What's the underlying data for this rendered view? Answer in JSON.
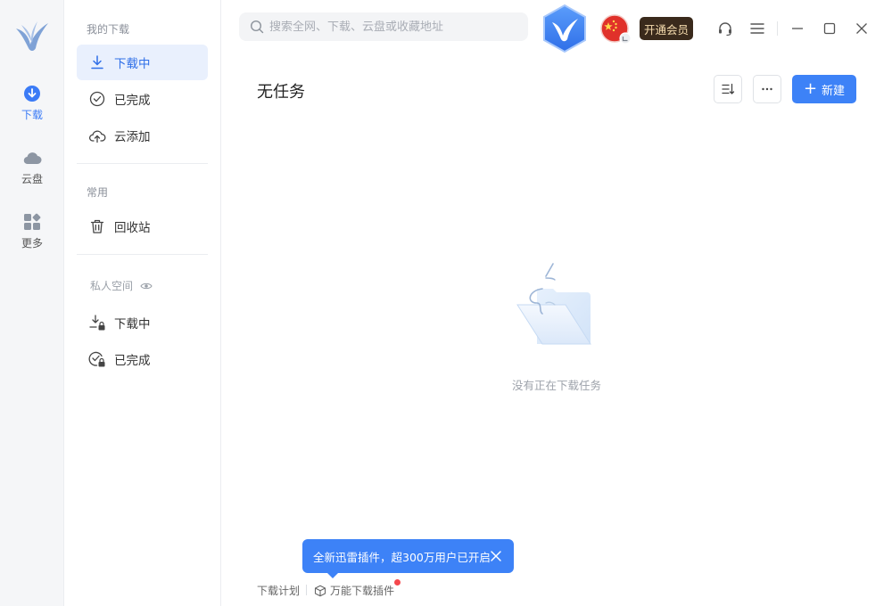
{
  "colors": {
    "accent": "#3d82f7",
    "rail_bg": "#f5f6f8",
    "vip_bg": "#3a2a1c",
    "vip_text": "#f6dcae",
    "notify_dot": "#f5484d"
  },
  "rail": {
    "items": [
      {
        "label": "下载",
        "icon": "download-circle-icon",
        "active": true
      },
      {
        "label": "云盘",
        "icon": "cloud-icon"
      },
      {
        "label": "更多",
        "icon": "apps-grid-icon"
      }
    ]
  },
  "panel": {
    "my_downloads_title": "我的下载",
    "items": [
      {
        "label": "下载中",
        "icon": "download-arrow-icon",
        "active": true
      },
      {
        "label": "已完成",
        "icon": "check-circle-icon"
      },
      {
        "label": "云添加",
        "icon": "cloud-upload-icon"
      }
    ],
    "common_title": "常用",
    "recycle_label": "回收站",
    "private_title": "私人空间",
    "private_items": [
      {
        "label": "下载中",
        "icon": "download-lock-icon"
      },
      {
        "label": "已完成",
        "icon": "check-lock-icon"
      }
    ]
  },
  "topbar": {
    "search_placeholder": "搜索全网、下载、云盘或收藏地址",
    "vip_label": "开通会员"
  },
  "main": {
    "title": "无任务",
    "new_label": "新建",
    "empty_text": "没有正在下载任务"
  },
  "tooltip": {
    "text": "全新迅雷插件，超300万用户已开启"
  },
  "footer": {
    "schedule_label": "下载计划",
    "plugin_label": "万能下载插件"
  }
}
